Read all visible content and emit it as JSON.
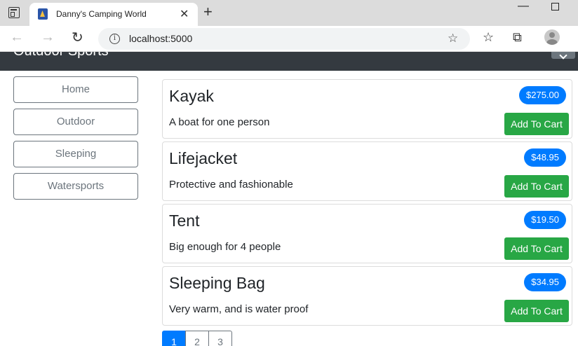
{
  "browser": {
    "tab_title": "Danny's Camping World",
    "tab_close": "✕",
    "new_tab": "+",
    "url": "localhost:5000",
    "info_glyph": "i",
    "icons": {
      "back": "arrow-left-icon",
      "forward": "arrow-right-icon",
      "reload": "reload-icon",
      "favorites_add": "star-plus-icon",
      "favorites": "favorites-list-icon",
      "collections": "collections-icon",
      "profile": "profile-avatar-icon"
    }
  },
  "navbar": {
    "brand": "Outdoor Sports",
    "background": "#343a40"
  },
  "categories": [
    {
      "label": "Home"
    },
    {
      "label": "Outdoor"
    },
    {
      "label": "Sleeping"
    },
    {
      "label": "Watersports"
    }
  ],
  "products": [
    {
      "name": "Kayak",
      "description": "A boat for one person",
      "price": "$275.00",
      "button": "Add To Cart"
    },
    {
      "name": "Lifejacket",
      "description": "Protective and fashionable",
      "price": "$48.95",
      "button": "Add To Cart"
    },
    {
      "name": "Tent",
      "description": "Big enough for 4 people",
      "price": "$19.50",
      "button": "Add To Cart"
    },
    {
      "name": "Sleeping Bag",
      "description": "Very warm, and is water proof",
      "price": "$34.95",
      "button": "Add To Cart"
    }
  ],
  "pagination": {
    "pages": [
      "1",
      "2",
      "3"
    ],
    "current": "1"
  },
  "colors": {
    "primary": "#007bff",
    "success": "#28a745",
    "secondary": "#6c757d"
  }
}
